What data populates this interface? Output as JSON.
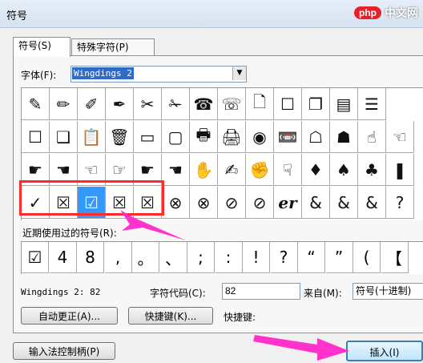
{
  "dialog": {
    "title": "符号"
  },
  "watermark": {
    "logo": "php",
    "text": "中文网"
  },
  "tabs": [
    {
      "label": "符号(S)"
    },
    {
      "label": "特殊字符(P)"
    }
  ],
  "font": {
    "label": "字体(F):",
    "value": "Wingdings 2"
  },
  "symbols": [
    [
      "✎",
      "✏",
      "✐",
      "✒",
      "✂",
      "✁",
      "☎",
      "☏",
      "🗋",
      "☐",
      "❐",
      "▤",
      "☰"
    ],
    [
      "☐",
      "❑",
      "📋",
      "🗑",
      "▭",
      "▢",
      "🖶",
      "🖨",
      "◉",
      "📼",
      "☖",
      "☗",
      "☝",
      "☜"
    ],
    [
      "☛",
      "☚",
      "☜",
      "☞",
      "☛",
      "☚",
      "✋",
      "✍",
      "✊",
      "☟",
      "♦",
      "♠",
      "♣",
      "❚"
    ],
    [
      "✓",
      "☒",
      "☑",
      "☒",
      "☒",
      "⊗",
      "⊗",
      "⊘",
      "⊘",
      "er",
      "&",
      "&",
      "&",
      "?"
    ]
  ],
  "selected_symbol": "☑",
  "recent": {
    "label": "近期使用过的符号(R):",
    "symbols": [
      "☑",
      "4",
      "8",
      ",",
      "。",
      "、",
      ";",
      ":",
      "!",
      "?",
      "“",
      "”",
      "(",
      "【"
    ]
  },
  "info": {
    "font_code": "Wingdings 2: 82",
    "code_label": "字符代码(C):",
    "code_value": "82",
    "from_label": "来自(M):",
    "from_value": "符号(十进制)"
  },
  "buttons": {
    "autocorrect": "自动更正(A)...",
    "shortcut": "快捷键(K)...",
    "shortcut_label": "快捷键:",
    "ime": "输入法控制柄(P)",
    "insert": "插入(I)"
  },
  "colors": {
    "highlight": "#ff2a2a",
    "arrow": "#ff33cc",
    "selected": "#3399ff"
  }
}
